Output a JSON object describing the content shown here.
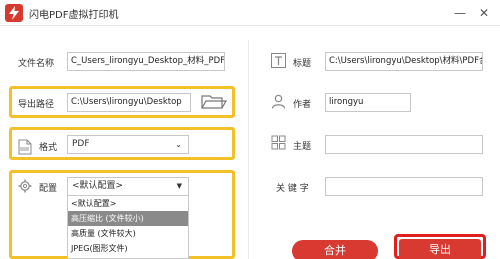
{
  "window": {
    "title": "闪电PDF虚拟打印机",
    "minimize_symbol": "—",
    "close_symbol": "✕"
  },
  "left": {
    "filename": {
      "label": "文件名称",
      "value": "C_Users_lirongyu_Desktop_材料_PDF转..."
    },
    "export_path": {
      "label": "导出路径",
      "value": "C:\\Users\\lirongyu\\Desktop"
    },
    "format": {
      "label": "格式",
      "value": "PDF"
    },
    "config": {
      "label": "配置",
      "value": "<默认配置>",
      "options": [
        "<默认配置>",
        "高压缩比 (文件较小)",
        "高质量 (文件较大)",
        "JPEG(图形文件)"
      ],
      "selected_index": 1
    }
  },
  "right": {
    "title_field": {
      "label": "标题",
      "value": "C:\\Users\\lirongyu\\Desktop\\材料\\PDF合"
    },
    "author": {
      "label": "作者",
      "value": "lirongyu"
    },
    "subject": {
      "label": "主题",
      "value": ""
    },
    "keywords": {
      "label": "关 键 字",
      "value": ""
    }
  },
  "buttons": {
    "merge": "合并",
    "export": "导出"
  },
  "colors": {
    "accent_red": "#d83a32",
    "highlight_yellow": "#f2c128",
    "highlight_red": "#e02020"
  }
}
